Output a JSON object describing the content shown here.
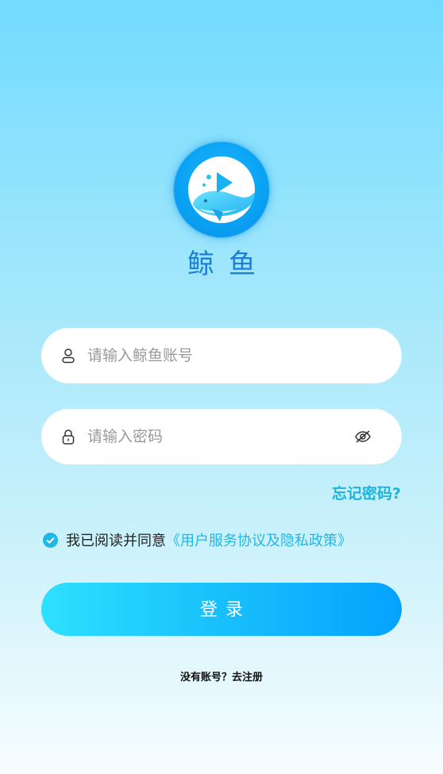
{
  "app": {
    "name": "鲸鱼",
    "logo_icon": "whale-play-icon",
    "brand_color": "#1e7fd9",
    "accent_color": "#1fb8e6"
  },
  "form": {
    "account_placeholder": "请输入鲸鱼账号",
    "password_placeholder": "请输入密码",
    "account_icon": "user-icon",
    "password_icon": "lock-icon",
    "visibility_icon": "eye-off-icon"
  },
  "forgot_password": "忘记密码?",
  "agreement": {
    "checked": true,
    "text": "我已阅读并同意",
    "link": "《用户服务协议及隐私政策》"
  },
  "login_button": "登录",
  "register_link": "没有账号？去注册"
}
